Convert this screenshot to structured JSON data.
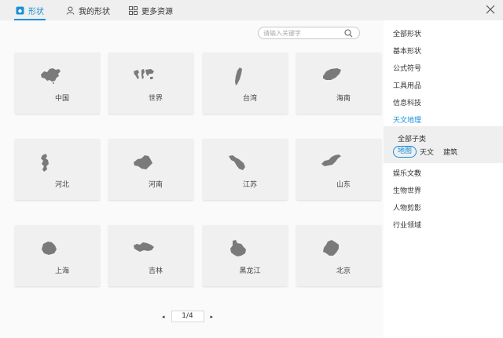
{
  "tabs": [
    {
      "label": "形状",
      "active": true
    },
    {
      "label": "我的形状",
      "active": false
    },
    {
      "label": "更多资源",
      "active": false
    }
  ],
  "search": {
    "placeholder": "请输入关键字",
    "value": ""
  },
  "cards": [
    {
      "label": "中国"
    },
    {
      "label": "世界"
    },
    {
      "label": "台湾"
    },
    {
      "label": "海南"
    },
    {
      "label": "河北"
    },
    {
      "label": "河南"
    },
    {
      "label": "江苏"
    },
    {
      "label": "山东"
    },
    {
      "label": "上海"
    },
    {
      "label": "吉林"
    },
    {
      "label": "黑龙江"
    },
    {
      "label": "北京"
    }
  ],
  "pagination": {
    "prev": "◂",
    "current": "1/4",
    "next": "▸"
  },
  "sidebar": {
    "categories_top": [
      "全部形状",
      "基本形状",
      "公式符号",
      "工具用品",
      "信息科技",
      "天文地理"
    ],
    "active_category": "天文地理",
    "sub": {
      "title": "全部子类",
      "items": [
        "地图",
        "天文",
        "建筑"
      ],
      "selected": "地图"
    },
    "categories_bottom": [
      "娱乐文教",
      "生物世界",
      "人物剪影",
      "行业领域"
    ]
  },
  "colors": {
    "accent": "#1a8fd8",
    "shape": "#7a7a7a"
  }
}
